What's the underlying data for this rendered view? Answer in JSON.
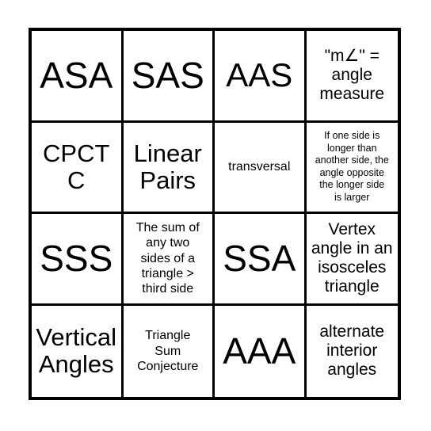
{
  "card": {
    "type": "bingo-card",
    "rows": 4,
    "columns": 4,
    "background_color": "#ffffff",
    "border_color": "#000000",
    "cells": [
      {
        "text": "ASA",
        "size": "sz-xl"
      },
      {
        "text": "SAS",
        "size": "sz-xl"
      },
      {
        "text": "AAS",
        "size": "sz-lg"
      },
      {
        "text": "\"m∠\" =\nangle\nmeasure",
        "size": "sz-sm"
      },
      {
        "text": "CPCTC",
        "size": "sz-md"
      },
      {
        "text": "Linear\nPairs",
        "size": "sz-md"
      },
      {
        "text": "transversal",
        "size": "sz-xs"
      },
      {
        "text": "If one side is\nlonger than\nanother side, the\nangle opposite\nthe longer side\nis larger",
        "size": "sz-xxs"
      },
      {
        "text": "SSS",
        "size": "sz-xl"
      },
      {
        "text": "The sum of\nany two\nsides of a\ntriangle >\nthird side",
        "size": "sz-xs"
      },
      {
        "text": "SSA",
        "size": "sz-xl"
      },
      {
        "text": "Vertex\nangle in an\nisosceles\ntriangle",
        "size": "sz-sm"
      },
      {
        "text": "Vertical\nAngles",
        "size": "sz-md"
      },
      {
        "text": "Triangle\nSum\nConjecture",
        "size": "sz-xs"
      },
      {
        "text": "AAA",
        "size": "sz-xl"
      },
      {
        "text": "alternate\ninterior\nangles",
        "size": "sz-sm"
      }
    ]
  }
}
